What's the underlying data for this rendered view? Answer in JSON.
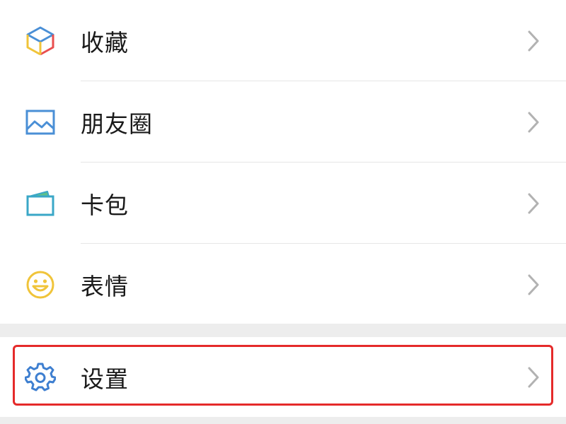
{
  "menu_items": [
    {
      "label": "收藏",
      "icon": "favorites-cube-icon"
    },
    {
      "label": "朋友圈",
      "icon": "moments-picture-icon"
    },
    {
      "label": "卡包",
      "icon": "card-wallet-icon"
    },
    {
      "label": "表情",
      "icon": "sticker-smiley-icon"
    }
  ],
  "settings_item": {
    "label": "设置",
    "icon": "gear-icon"
  },
  "chevron_icon": "chevron-right-icon",
  "colors": {
    "background": "#ededed",
    "row": "#ffffff",
    "highlight_border": "#e52a2a",
    "chevron": "#b2b2b2",
    "moments_blue": "#4a8fd6",
    "card_teal": "#3aa7c7",
    "smiley_yellow": "#f0c43a",
    "gear_blue": "#3e7fd0"
  }
}
